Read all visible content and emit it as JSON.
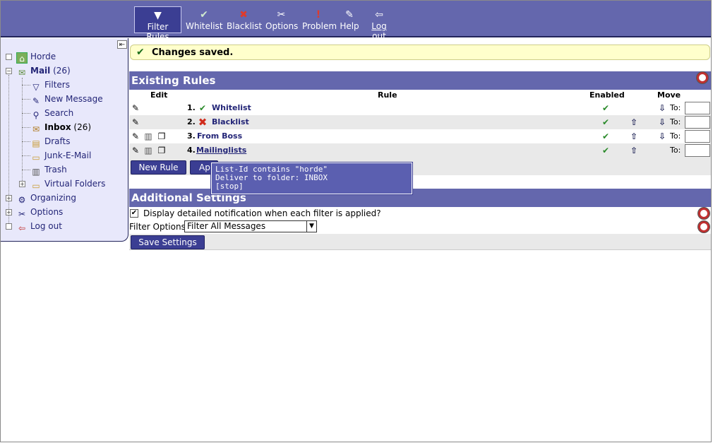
{
  "toolbar": {
    "items": [
      {
        "label": "Filter Rules",
        "icon": "filter-icon",
        "glyph": "▼"
      },
      {
        "label": "Whitelist",
        "icon": "check-icon",
        "glyph": "✔"
      },
      {
        "label": "Blacklist",
        "icon": "x-icon",
        "glyph": "✖"
      },
      {
        "label": "Options",
        "icon": "tools-icon",
        "glyph": "✂"
      },
      {
        "label": "Problem",
        "icon": "exclamation-icon",
        "glyph": "!"
      },
      {
        "label": "Help",
        "icon": "help-book-icon",
        "glyph": "✎"
      },
      {
        "label": "Log out",
        "icon": "logout-icon",
        "glyph": "⇦"
      }
    ]
  },
  "sidebar": {
    "horde": "Horde",
    "mail": "Mail",
    "mail_count": "(26)",
    "filters": "Filters",
    "new_message": "New Message",
    "search": "Search",
    "inbox": "Inbox",
    "inbox_count": "(26)",
    "drafts": "Drafts",
    "junk": "Junk-E-Mail",
    "trash": "Trash",
    "virtual": "Virtual Folders",
    "organizing": "Organizing",
    "options": "Options",
    "logout": "Log out"
  },
  "notice": "Changes saved.",
  "rules_section": {
    "title": "Existing Rules",
    "headers": {
      "edit": "Edit",
      "rule": "Rule",
      "enabled": "Enabled",
      "move": "Move"
    },
    "to_label": "To:",
    "rows": [
      {
        "num": "1.",
        "name": "Whitelist"
      },
      {
        "num": "2.",
        "name": "Blacklist"
      },
      {
        "num": "3.",
        "name": "From Boss"
      },
      {
        "num": "4.",
        "name": "Mailinglists"
      }
    ],
    "new_rule": "New Rule",
    "apply_partial": "Ap"
  },
  "tooltip": "List-Id contains \"horde\"\nDeliver to folder: INBOX\n[stop]",
  "settings": {
    "title": "Additional Settings",
    "notify_label": "Display detailed notification when each filter is applied?",
    "filter_options_label": "Filter Options",
    "filter_options_value": "Filter All Messages",
    "save": "Save Settings"
  },
  "colors": {
    "header_bar": "#6467ad",
    "sidebar_bg": "#e8e8fb",
    "link": "#232577",
    "notice_bg": "#ffffcc"
  }
}
